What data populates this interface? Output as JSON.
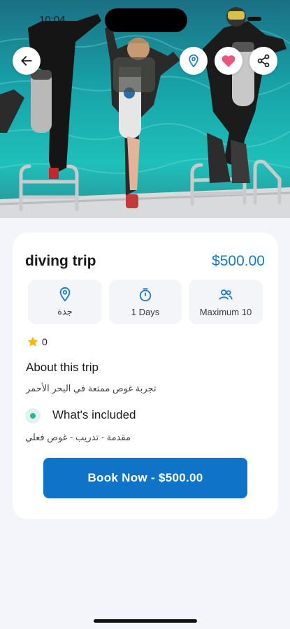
{
  "status_bar": {
    "time": "10:04"
  },
  "hero": {
    "image_alt": "divers jumping off boat into turquoise water"
  },
  "header_actions": {
    "back_icon": "arrow-left-icon",
    "location_icon": "map-pin-icon",
    "favorite_icon": "heart-icon",
    "share_icon": "share-icon",
    "favorite_color": "#e8577e",
    "location_color": "#1a7ac6"
  },
  "trip": {
    "title": "diving trip",
    "price": "$500.00",
    "price_color": "#1a7ac6"
  },
  "info": [
    {
      "icon": "map-pin-icon",
      "label": "جدة"
    },
    {
      "icon": "timer-icon",
      "label": "1 Days"
    },
    {
      "icon": "people-icon",
      "label": "Maximum 10"
    }
  ],
  "rating": {
    "icon": "star-icon",
    "value": "0"
  },
  "about": {
    "heading": "About this trip",
    "text": "تجربة غوص ممتعة في البحر الأحمر"
  },
  "included": {
    "heading": "What's included",
    "text": "مقدمة - تدريب - غوص فعلي"
  },
  "cta": {
    "label": "Book Now - $500.00",
    "color": "#0f74c8"
  }
}
